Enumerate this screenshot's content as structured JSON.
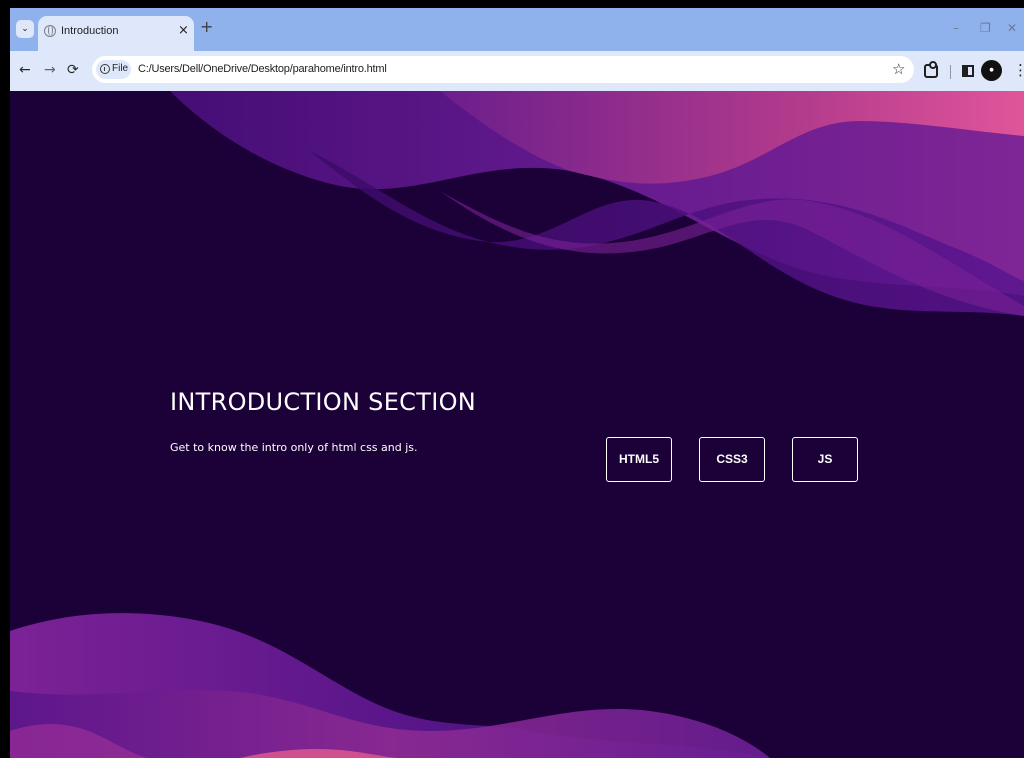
{
  "browser": {
    "tab": {
      "title": "Introduction",
      "close": "×"
    },
    "tab_menu": "⌄",
    "new_tab": "+",
    "window_controls": {
      "minimize": "–",
      "restore": "❐",
      "close": "✕"
    },
    "nav": {
      "back": "←",
      "forward": "→",
      "reload": "⟳"
    },
    "site_chip": "File",
    "url": "C:/Users/Dell/OneDrive/Desktop/parahome/intro.html",
    "bookmark": "☆",
    "menu": "⋮",
    "icons": [
      "tab-search-icon",
      "globe-icon",
      "close-icon",
      "plus-icon",
      "minimize-icon",
      "restore-icon",
      "back-arrow-icon",
      "forward-arrow-icon",
      "reload-icon",
      "info-icon",
      "star-icon",
      "extensions-icon",
      "side-panel-icon",
      "profile-avatar",
      "kebab-menu-icon"
    ]
  },
  "page": {
    "title": "INTRODUCTION SECTION",
    "subtitle": "Get to know the intro only of html css and js.",
    "buttons": [
      "HTML5",
      "CSS3",
      "JS"
    ],
    "colors": {
      "background": "#1c0038",
      "wave_dark": "#3e0a6e",
      "wave_purple": "#6a1b9a",
      "wave_pink": "#c2418f",
      "text": "#ffffff"
    }
  }
}
